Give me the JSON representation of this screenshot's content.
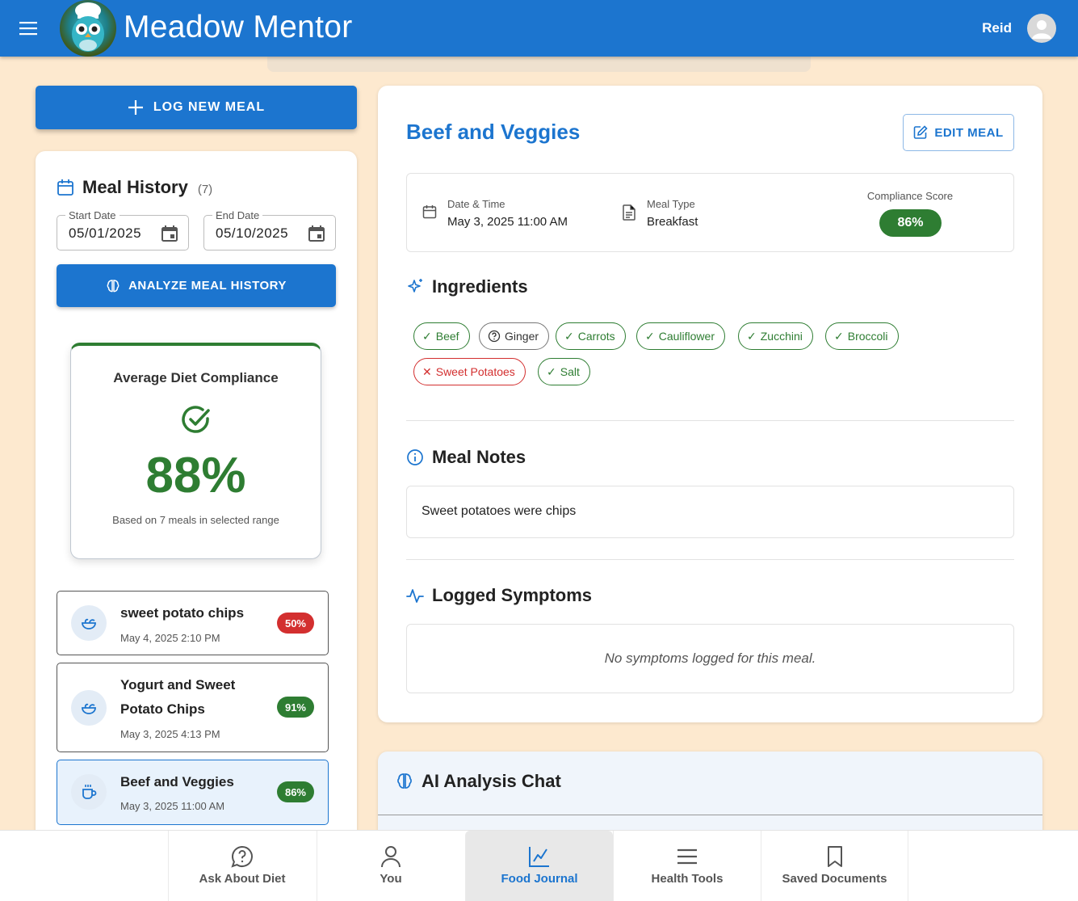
{
  "app": {
    "title": "Meadow Mentor",
    "user_name": "Reid",
    "icons": {
      "menu": "hamburger-menu-icon",
      "avatar": "person-avatar-icon",
      "logo": "owl-chef-logo"
    }
  },
  "left": {
    "log_button": "LOG NEW MEAL",
    "history": {
      "title": "Meal History",
      "count": "(7)",
      "start_label": "Start Date",
      "start_value": "05/01/2025",
      "end_label": "End Date",
      "end_value": "05/10/2025",
      "analyze_button": "ANALYZE MEAL HISTORY"
    },
    "compliance": {
      "title": "Average Diet Compliance",
      "value": "88%",
      "subtitle": "Based on 7 meals in selected range"
    },
    "meals": [
      {
        "name": "sweet potato chips",
        "date": "May 4, 2025 2:10 PM",
        "score": "50%",
        "status": "red"
      },
      {
        "name": "Yogurt and Sweet Potato Chips",
        "date": "May 3, 2025 4:13 PM",
        "score": "91%",
        "status": "green"
      },
      {
        "name": "Beef and Veggies",
        "date": "May 3, 2025 11:00 AM",
        "score": "86%",
        "status": "green",
        "selected": true
      }
    ]
  },
  "detail": {
    "title": "Beef and Veggies",
    "edit_button": "EDIT MEAL",
    "date_label": "Date & Time",
    "date_value": "May 3, 2025 11:00 AM",
    "type_label": "Meal Type",
    "type_value": "Breakfast",
    "score_label": "Compliance Score",
    "score_value": "86%",
    "ingredients_title": "Ingredients",
    "ingredients": [
      {
        "name": "Beef",
        "status": "ok"
      },
      {
        "name": "Ginger",
        "status": "unknown"
      },
      {
        "name": "Carrots",
        "status": "ok"
      },
      {
        "name": "Cauliflower",
        "status": "ok"
      },
      {
        "name": "Zucchini",
        "status": "ok"
      },
      {
        "name": "Broccoli",
        "status": "ok"
      },
      {
        "name": "Sweet Potatoes",
        "status": "bad"
      },
      {
        "name": "Salt",
        "status": "ok"
      }
    ],
    "notes_title": "Meal Notes",
    "notes": "Sweet potatoes were chips",
    "symptoms_title": "Logged Symptoms",
    "symptoms_empty": "No symptoms logged for this meal."
  },
  "chat": {
    "title": "AI Analysis Chat"
  },
  "nav": [
    {
      "label": "Ask About Diet",
      "icon": "question-bubble-icon"
    },
    {
      "label": "You",
      "icon": "person-icon"
    },
    {
      "label": "Food Journal",
      "icon": "line-chart-icon",
      "active": true
    },
    {
      "label": "Health Tools",
      "icon": "list-lines-icon"
    },
    {
      "label": "Saved Documents",
      "icon": "bookmark-icon"
    }
  ],
  "colors": {
    "primary": "#1c75cf",
    "background": "#fde9cf",
    "success": "#2e7d32",
    "danger": "#d32f2f"
  }
}
